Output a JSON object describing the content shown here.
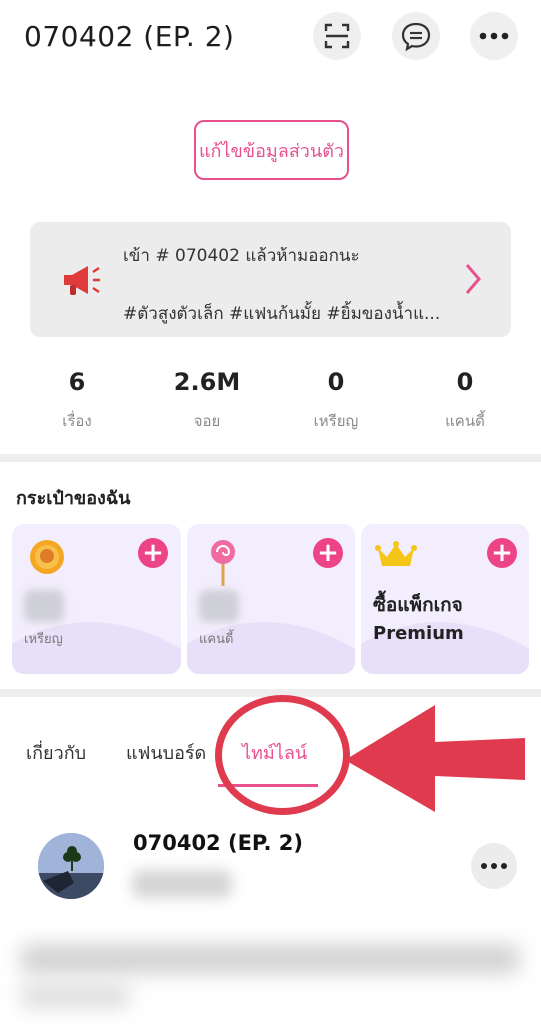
{
  "header": {
    "title": "070402 (EP. 2)",
    "icons": [
      "scan-icon",
      "chat-icon",
      "more-icon"
    ]
  },
  "profile": {
    "edit_button": "แก้ไขข้อมูลส่วนตัว"
  },
  "bio": {
    "line1": "เข้า # 070402 แล้วห้ามออกนะ",
    "line2": "#ตัวสูงตัวเล็ก #แฟนก้นมั้ย #ยิ้มของน้ำแ..."
  },
  "stats": [
    {
      "value": "6",
      "label": "เรื่อง"
    },
    {
      "value": "2.6M",
      "label": "จอย"
    },
    {
      "value": "0",
      "label": "เหรียญ"
    },
    {
      "value": "0",
      "label": "แคนดี้"
    }
  ],
  "wallet": {
    "title": "กระเป๋าของฉัน",
    "coin_label": "เหรียญ",
    "candy_label": "แคนดี้",
    "premium_line1": "ซื้อแพ็กเกจ",
    "premium_line2": "Premium"
  },
  "tabs": [
    {
      "label": "เกี่ยวกับ"
    },
    {
      "label": "แฟนบอร์ด"
    },
    {
      "label": "ไทม์ไลน์",
      "active": true
    }
  ],
  "post": {
    "author": "070402 (EP. 2)"
  },
  "colors": {
    "accent": "#e8508e",
    "plus": "#ec4486",
    "annotation": "#e03a4e",
    "card": "#f3eefd"
  }
}
